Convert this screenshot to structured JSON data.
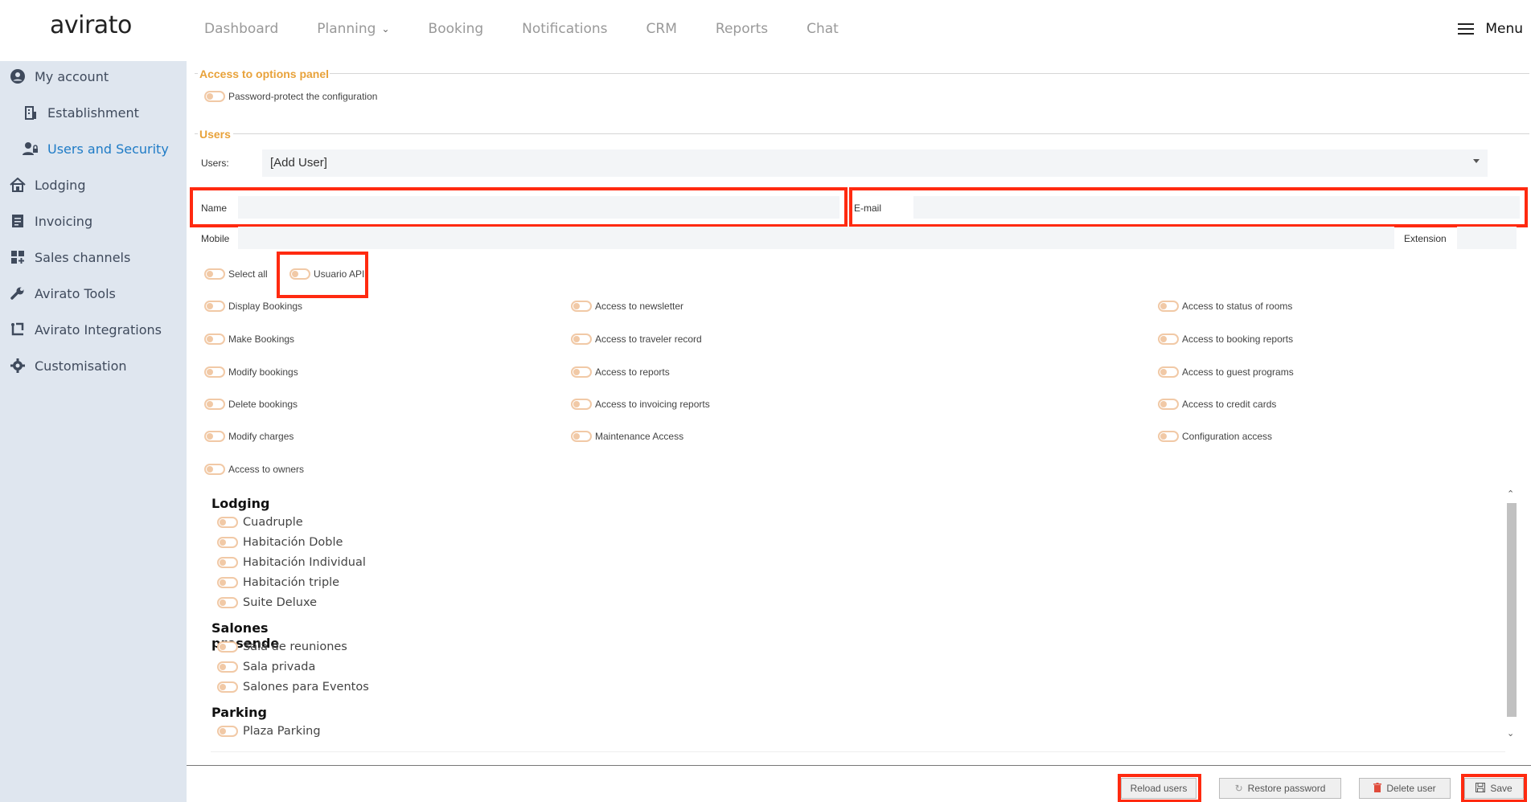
{
  "header": {
    "logo": "avirato",
    "nav": [
      "Dashboard",
      "Planning",
      "Booking",
      "Notifications",
      "CRM",
      "Reports",
      "Chat"
    ],
    "menu_label": "Menu"
  },
  "sidebar": {
    "items": [
      {
        "label": "My account",
        "icon": "user-circle-icon"
      },
      {
        "label": "Establishment",
        "icon": "building-icon"
      },
      {
        "label": "Users and Security",
        "icon": "user-lock-icon"
      },
      {
        "label": "Lodging",
        "icon": "home-icon"
      },
      {
        "label": "Invoicing",
        "icon": "invoice-icon"
      },
      {
        "label": "Sales channels",
        "icon": "grid-plus-icon"
      },
      {
        "label": "Avirato Tools",
        "icon": "wrench-icon"
      },
      {
        "label": "Avirato Integrations",
        "icon": "integration-icon"
      },
      {
        "label": "Customisation",
        "icon": "gear-icon"
      }
    ]
  },
  "options_panel": {
    "title": "Access to options panel",
    "password_protect": "Password-protect the configuration"
  },
  "users": {
    "title": "Users",
    "users_label": "Users:",
    "selected_user": "[Add User]",
    "name_label": "Name",
    "email_label": "E-mail",
    "mobile_label": "Mobile",
    "extension_label": "Extension",
    "select_all": "Select all",
    "api_user": "Usuario API"
  },
  "permissions": {
    "col1": [
      "Display Bookings",
      "Make Bookings",
      "Modify bookings",
      "Delete bookings",
      "Modify charges",
      "Access to owners"
    ],
    "col2": [
      "Access to newsletter",
      "Access to traveler record",
      "Access to reports",
      "Access to invoicing reports",
      "Maintenance Access"
    ],
    "col3": [
      "Access to status of rooms",
      "Access to booking reports",
      "Access to guest programs",
      "Access to credit cards",
      "Configuration access"
    ]
  },
  "rooms": {
    "groups": [
      {
        "name": "Lodging",
        "items": [
          "Cuadruple",
          "Habitación Doble",
          "Habitación Individual",
          "Habitación triple",
          "Suite Deluxe"
        ]
      },
      {
        "name": "Salones presende",
        "items": [
          "Sala de reuniones",
          "Sala privada",
          "Salones para Eventos"
        ]
      },
      {
        "name": "Parking",
        "items": [
          "Plaza Parking"
        ]
      }
    ]
  },
  "footer": {
    "reload": "Reload users",
    "restore": "Restore password",
    "delete": "Delete user",
    "save": "Save"
  },
  "colors": {
    "accent": "#e8a23a",
    "active": "#1e7bc6",
    "highlight": "#ff2a10",
    "sidebar_bg": "#dfe6ef"
  }
}
